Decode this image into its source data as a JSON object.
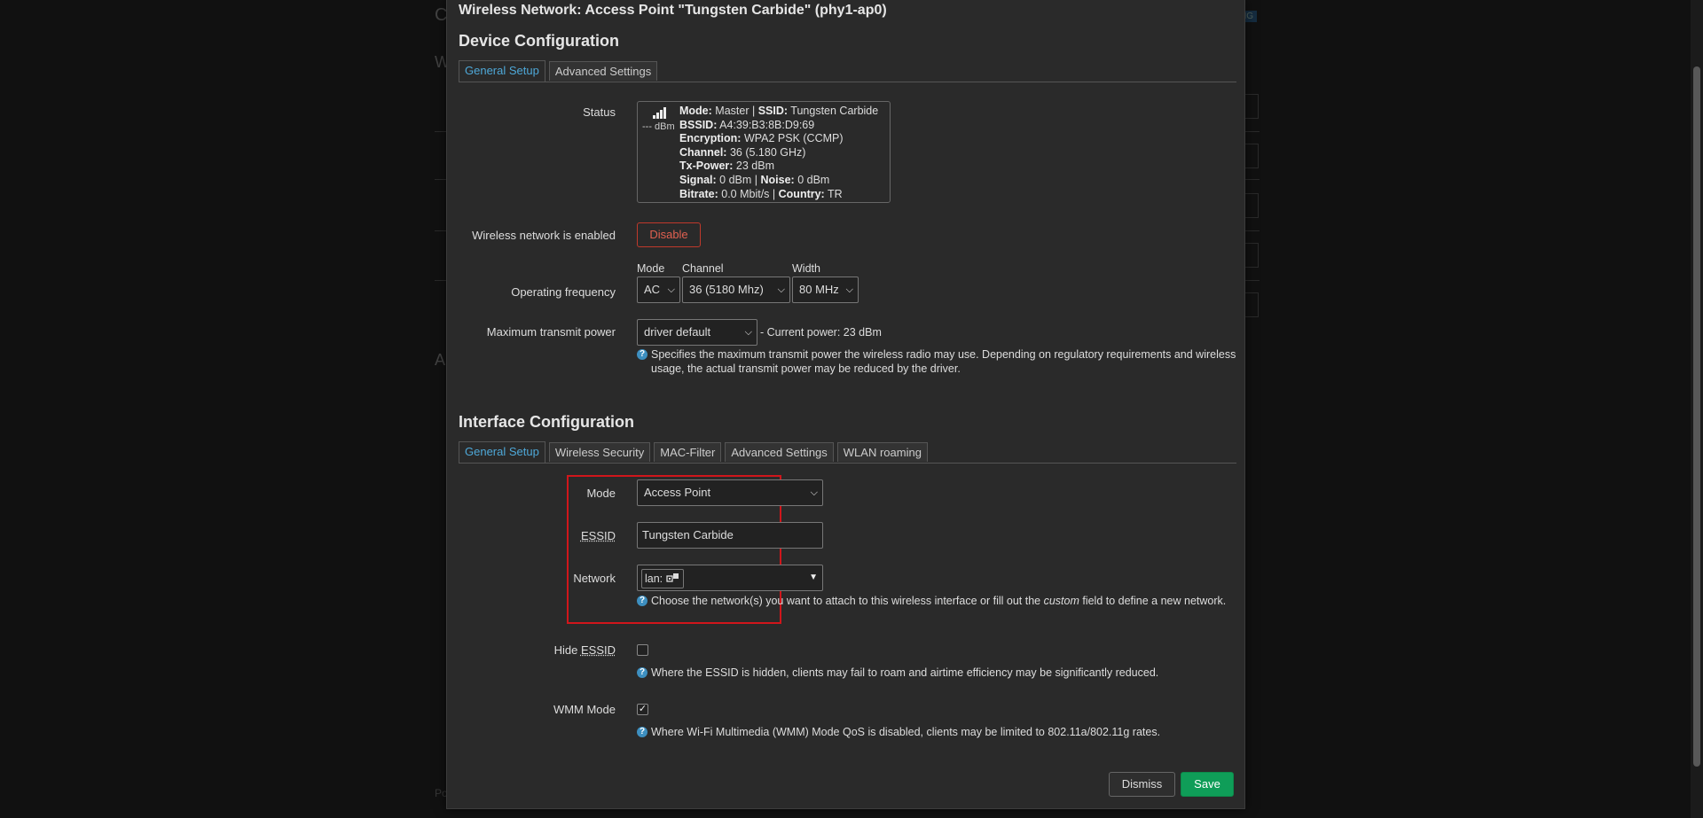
{
  "background": {
    "title": "C",
    "subtitle": "W",
    "subtitle2": "A",
    "badge": "HING",
    "footer": "Po"
  },
  "modal": {
    "title": "Wireless Network: Access Point \"Tungsten Carbide\" (phy1-ap0)",
    "device_section": "Device Configuration",
    "device_tabs": [
      "General Setup",
      "Advanced Settings"
    ],
    "status_label": "Status",
    "status": {
      "signal_text": "--- dBm",
      "mode_key": "Mode:",
      "mode_val": "Master",
      "ssid_key": "SSID:",
      "ssid_val": "Tungsten Carbide",
      "bssid_key": "BSSID:",
      "bssid_val": "A4:39:B3:8B:D9:69",
      "enc_key": "Encryption:",
      "enc_val": "WPA2 PSK (CCMP)",
      "chan_key": "Channel:",
      "chan_val": "36 (5.180 GHz)",
      "tx_key": "Tx-Power:",
      "tx_val": "23 dBm",
      "sig_key": "Signal:",
      "sig_val": "0 dBm",
      "noise_key": "Noise:",
      "noise_val": "0 dBm",
      "bitrate_key": "Bitrate:",
      "bitrate_val": "0.0 Mbit/s",
      "country_key": "Country:",
      "country_val": "TR"
    },
    "enabled_label": "Wireless network is enabled",
    "disable_button": "Disable",
    "freq_label": "Operating frequency",
    "freq": {
      "mode_label": "Mode",
      "mode_value": "AC",
      "channel_label": "Channel",
      "channel_value": "36 (5180 Mhz)",
      "width_label": "Width",
      "width_value": "80 MHz"
    },
    "txpower_label": "Maximum transmit power",
    "txpower_value": "driver default",
    "txpower_current": "- Current power: 23 dBm",
    "txpower_help": "Specifies the maximum transmit power the wireless radio may use. Depending on regulatory requirements and wireless usage, the actual transmit power may be reduced by the driver.",
    "interface_section": "Interface Configuration",
    "interface_tabs": [
      "General Setup",
      "Wireless Security",
      "MAC-Filter",
      "Advanced Settings",
      "WLAN roaming"
    ],
    "if_mode_label": "Mode",
    "if_mode_value": "Access Point",
    "essid_label": "ESSID",
    "essid_value": "Tungsten Carbide",
    "network_label": "Network",
    "network_value": "lan:",
    "network_help_a": "Choose the network(s) you want to attach to this wireless interface or fill out the ",
    "network_help_em": "custom",
    "network_help_b": " field to define a new network.",
    "hide_label_pre": "Hide ",
    "hide_label_abbr": "ESSID",
    "hide_help": "Where the ESSID is hidden, clients may fail to roam and airtime efficiency may be significantly reduced.",
    "hide_checked": false,
    "wmm_label": "WMM Mode",
    "wmm_help": "Where Wi-Fi Multimedia (WMM) Mode QoS is disabled, clients may be limited to 802.11a/802.11g rates.",
    "wmm_checked": true,
    "dismiss_button": "Dismiss",
    "save_button": "Save",
    "colors": {
      "accent": "#4ea8d8",
      "danger": "#e06050",
      "save": "#0f9d58",
      "highlight": "#d0161b"
    }
  }
}
